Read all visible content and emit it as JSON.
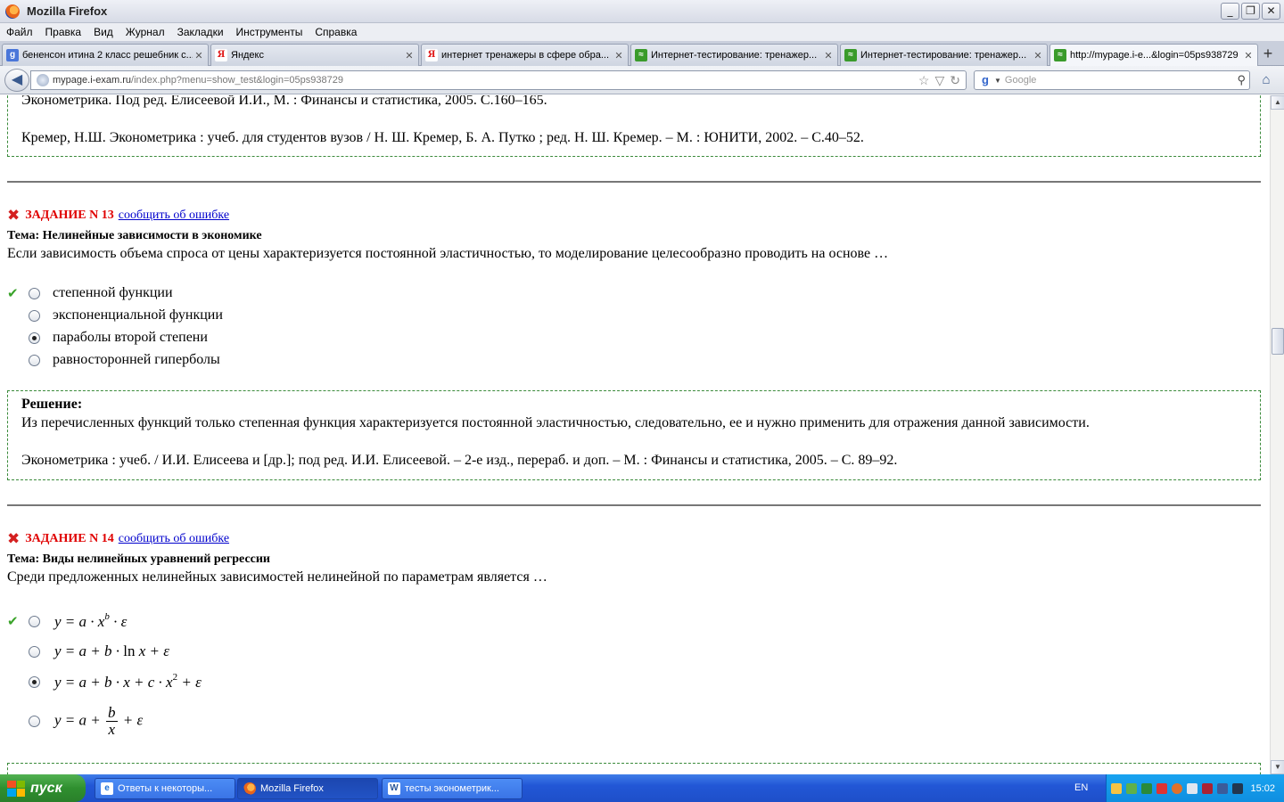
{
  "window": {
    "title": "Mozilla Firefox",
    "buttons": [
      "_",
      "❐",
      "✕"
    ]
  },
  "menu": [
    "Файл",
    "Правка",
    "Вид",
    "Журнал",
    "Закладки",
    "Инструменты",
    "Справка"
  ],
  "tabs": [
    {
      "label": "бененсон итина 2 класс решебник с...",
      "icon": "g"
    },
    {
      "label": "Яндекс",
      "icon": "y"
    },
    {
      "label": "интернет тренажеры в сфере обра...",
      "icon": "y"
    },
    {
      "label": "Интернет-тестирование: тренажер...",
      "icon": "e"
    },
    {
      "label": "Интернет-тестирование: тренажер...",
      "icon": "e"
    },
    {
      "label": "http://mypage.i-e...&login=05ps938729",
      "icon": "e"
    }
  ],
  "nav": {
    "url_host": "mypage.i-exam.ru",
    "url_path": "/index.php?menu=show_test&login=05ps938729",
    "search_placeholder": "Google",
    "search_engine_letter": "g"
  },
  "content": {
    "prev_refs": [
      "Эконометрика. Под ред. Елисеевой И.И., М. : Финансы и статистика, 2005. С.160–165.",
      "Кремер, Н.Ш. Эконометрика : учеб. для студентов вузов / Н. Ш. Кремер, Б. А. Путко ; ред. Н. Ш. Кремер. – М. : ЮНИТИ, 2002. – С.40–52."
    ],
    "report_link": "сообщить об ошибке",
    "task13": {
      "number": "ЗАДАНИЕ N 13",
      "topic": "Тема: Нелинейные зависимости в экономике",
      "question": "Если зависимость объема спроса от цены характеризуется постоянной эластичностью, то моделирование целесообразно проводить на основе …",
      "options": [
        "степенной функции",
        "экспоненциальной функции",
        "параболы второй степени",
        "равносторонней гиперболы"
      ],
      "correct_index": 0,
      "selected_index": 2,
      "solution_title": "Решение:",
      "solution_text": "Из перечисленных функций только степенная функция характеризуется постоянной эластичностью, следовательно, ее и нужно применить для отражения данной зависимости.",
      "solution_ref": "Эконометрика : учеб. / И.И. Елисеева и [др.]; под ред. И.И. Елисеевой. – 2-е изд., перераб. и доп. – М. : Финансы и статистика, 2005. – С. 89–92."
    },
    "task14": {
      "number": "ЗАДАНИЕ N 14",
      "topic": "Тема: Виды нелинейных уравнений регрессии",
      "question": "Среди предложенных нелинейных зависимостей нелинейной по параметрам является …",
      "options": [
        "y = a · x^b · ε",
        "y = a + b · ln x + ε",
        "y = a + b · x + c · x^2 + ε",
        "y = a + b/x + ε"
      ],
      "correct_index": 0,
      "selected_index": 2
    }
  },
  "taskbar": {
    "start_label": "пуск",
    "buttons": [
      {
        "label": "Ответы к некоторы...",
        "icon": "ie"
      },
      {
        "label": "Mozilla Firefox",
        "icon": "ff"
      },
      {
        "label": "тесты эконометрик...",
        "icon": "word"
      }
    ],
    "language": "EN",
    "clock": "15:02"
  },
  "colors": {
    "task_number": "#e00000",
    "link": "#0000cc",
    "solution_border": "#3a8a3a",
    "correct_check": "#3aa32a",
    "wrong_mark": "#d42020",
    "taskbar": "#2257d6",
    "start_button": "#2f8f2f"
  }
}
